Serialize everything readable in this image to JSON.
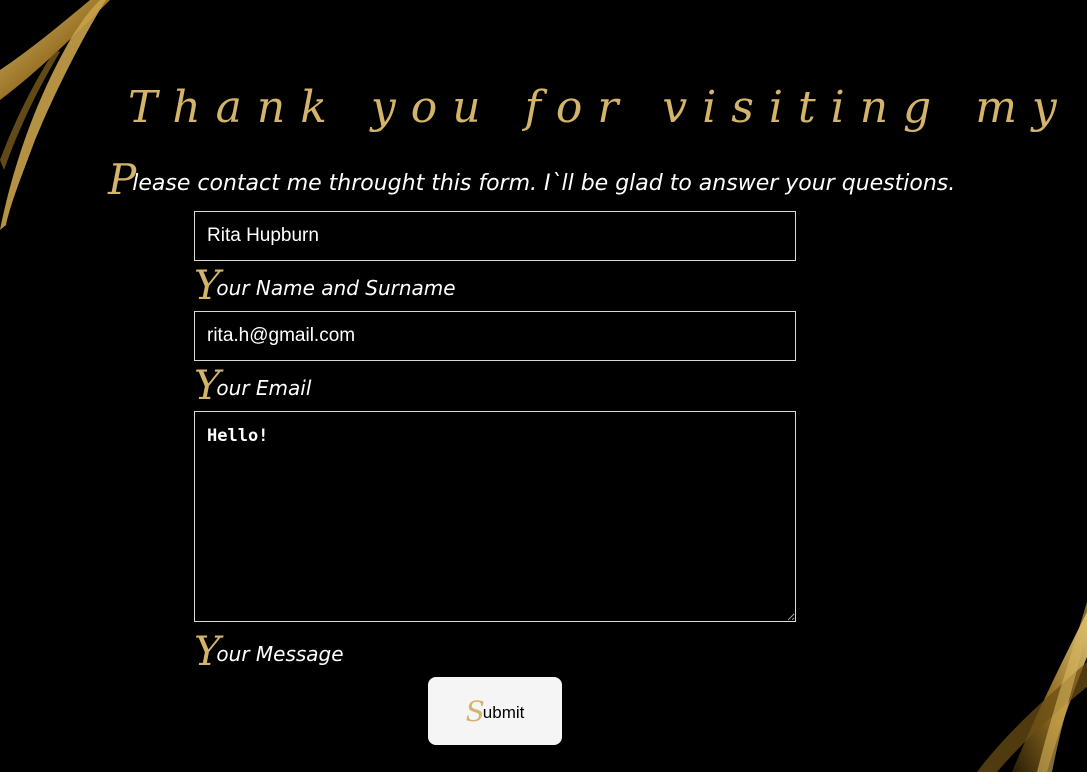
{
  "page": {
    "title": "Thank you for visiting my Site!",
    "intro_first_letter": "P",
    "intro_rest": "lease contact me throught this form. I`ll be glad to answer your questions."
  },
  "form": {
    "name_value": "Rita Hupburn",
    "name_label_first": "Y",
    "name_label_rest": "our Name and Surname",
    "email_value": "rita.h@gmail.com",
    "email_label_first": "Y",
    "email_label_rest": "our Email",
    "message_value": "Hello!",
    "message_label_first": "Y",
    "message_label_rest": "our Message",
    "submit_first": "S",
    "submit_rest": "ubmit"
  },
  "colors": {
    "background": "#000000",
    "gold_accent": "#d4b46a",
    "text": "#ffffff",
    "button_bg": "#f5f5f5"
  }
}
